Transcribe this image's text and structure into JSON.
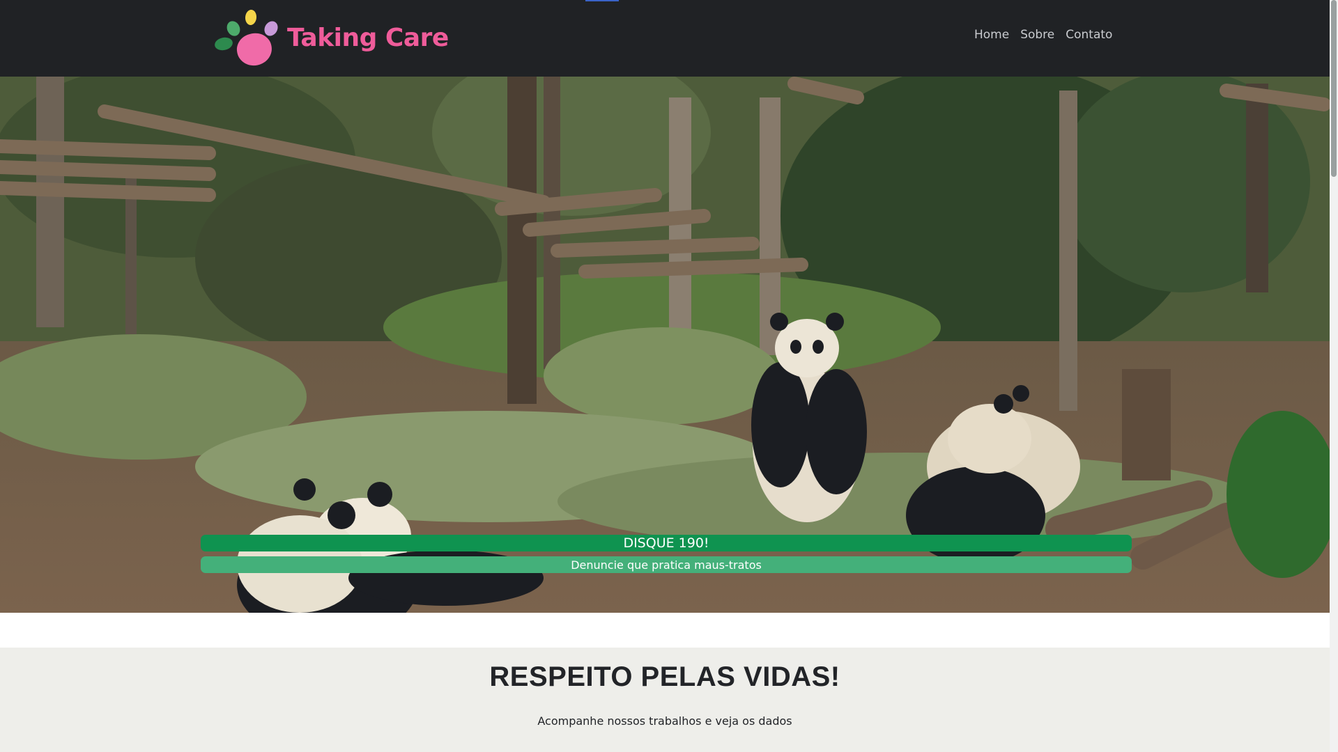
{
  "brand": {
    "name": "Taking Care"
  },
  "nav": {
    "links": [
      "Home",
      "Sobre",
      "Contato"
    ]
  },
  "hero": {
    "banner_primary": "DISQUE 190!",
    "banner_secondary": "Denuncie que pratica maus-tratos"
  },
  "section": {
    "title": "RESPEITO PELAS VIDAS!",
    "subtitle": "Acompanhe nossos trabalhos e veja os dados"
  },
  "colors": {
    "navbar_bg": "#202225",
    "brand_pink": "#ef5c9a",
    "banner_green": "#0f9350",
    "banner_green_light": "#44b07a",
    "section_bg": "#eeeeea"
  },
  "icons": {
    "logo": "paw-icon"
  }
}
